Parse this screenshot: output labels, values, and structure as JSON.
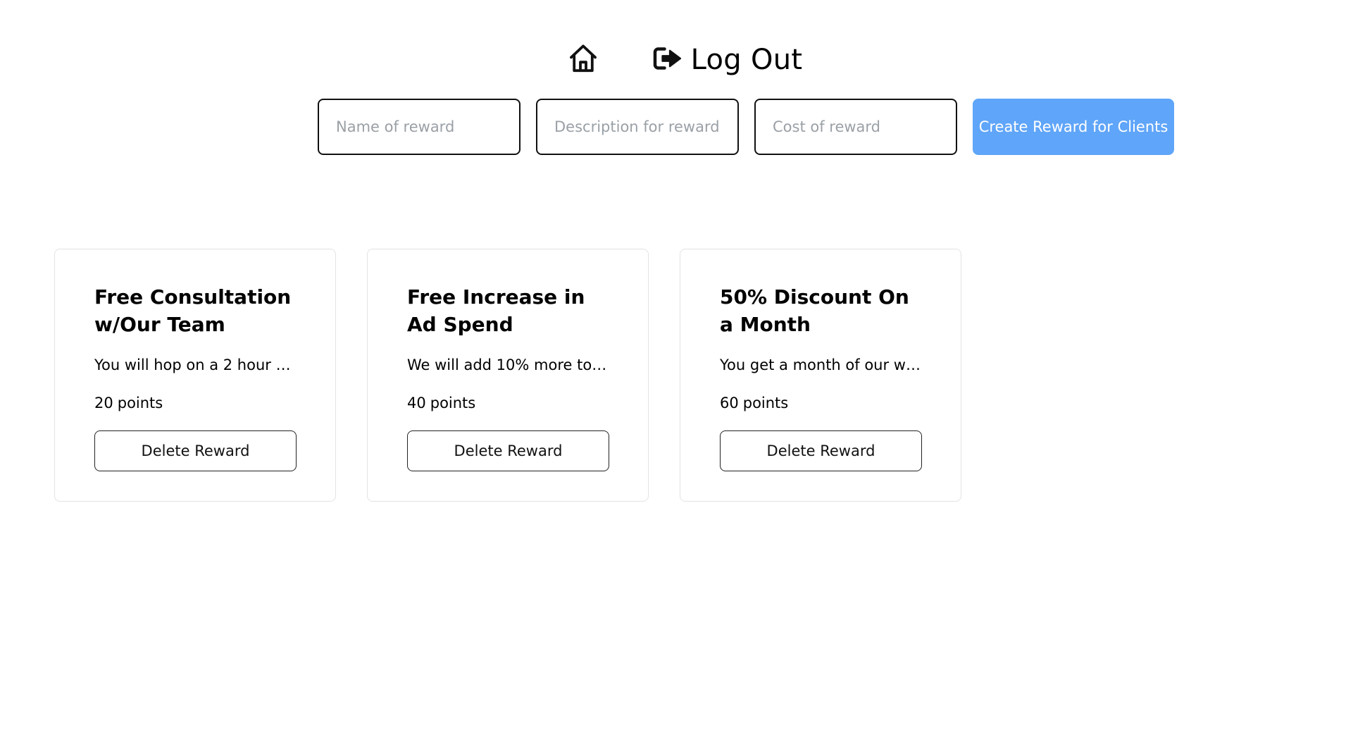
{
  "nav": {
    "home_icon": "home-icon",
    "logout_icon": "sign-out-icon",
    "logout_label": "Log Out"
  },
  "form": {
    "name_placeholder": "Name of reward",
    "description_placeholder": "Description for reward",
    "cost_placeholder": "Cost of reward",
    "create_label": "Create Reward for Clients"
  },
  "colors": {
    "accent": "#5fa5f9",
    "border": "#111111",
    "card_border": "#e3e3e3"
  },
  "rewards": [
    {
      "title": "Free Consultation w/Our Team",
      "description": "You will hop on a 2 hour ca...",
      "cost": "20",
      "cost_unit": "points",
      "delete_label": "Delete Reward"
    },
    {
      "title": "Free Increase in Ad Spend",
      "description": "We will add 10% more to y...",
      "cost": "40",
      "cost_unit": "points",
      "delete_label": "Delete Reward"
    },
    {
      "title": "50% Discount On a Month",
      "description": "You get a month of our wo...",
      "cost": "60",
      "cost_unit": "points",
      "delete_label": "Delete Reward"
    }
  ]
}
